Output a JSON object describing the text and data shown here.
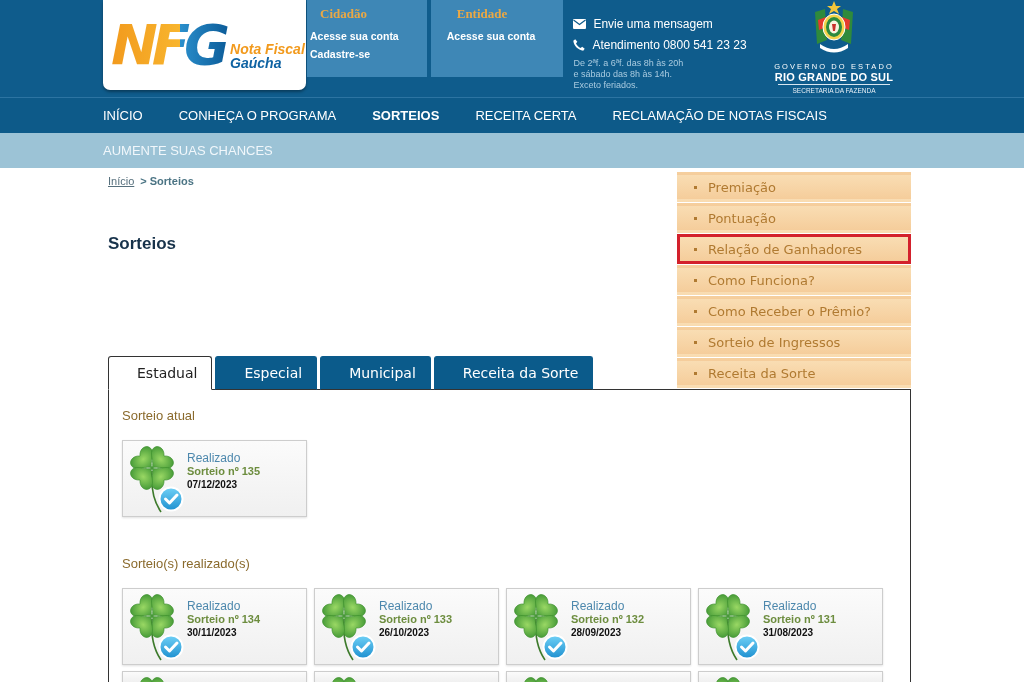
{
  "header": {
    "logo": {
      "mark": "NFG",
      "line_1": "Nota Fiscal",
      "line_2": "Gaúcha"
    },
    "account_panels": [
      {
        "title": "Cidadão",
        "links": [
          "Acesse sua conta",
          "Cadastre-se"
        ]
      },
      {
        "title": "Entidade",
        "links": [
          "Acesse sua conta"
        ]
      }
    ],
    "contact": {
      "items": [
        {
          "kind": "email",
          "label": "Envie uma mensagem"
        },
        {
          "kind": "phone",
          "label": "Atendimento 0800 541 23 23"
        }
      ],
      "hours": [
        "De 2ªf. a 6ªf. das 8h às 20h",
        "e sábado das 8h às 14h.",
        "Exceto feriados."
      ]
    },
    "government": {
      "line_1": "GOVERNO DO ESTADO",
      "line_2": "RIO GRANDE DO SUL",
      "line_3": "SECRETARIA DA FAZENDA"
    }
  },
  "nav": [
    {
      "label": "INÍCIO",
      "selected": false
    },
    {
      "label": "CONHEÇA O PROGRAMA",
      "selected": false
    },
    {
      "label": "SORTEIOS",
      "selected": true
    },
    {
      "label": "RECEITA CERTA",
      "selected": false
    },
    {
      "label": "RECLAMAÇÃO DE NOTAS FISCAIS",
      "selected": false
    }
  ],
  "subnav": [
    "AUMENTE SUAS CHANCES"
  ],
  "breadcrumb": [
    {
      "kind": "link",
      "label": "Início"
    },
    {
      "kind": "current",
      "label": "> Sorteios"
    }
  ],
  "page_title": "Sorteios",
  "sidebar": [
    {
      "label": "Premiação",
      "highlighted": false
    },
    {
      "label": "Pontuação",
      "highlighted": false
    },
    {
      "label": "Relação de Ganhadores",
      "highlighted": true
    },
    {
      "label": "Como Funciona?",
      "highlighted": false
    },
    {
      "label": "Como Receber o Prêmio?",
      "highlighted": false
    },
    {
      "label": "Sorteio de Ingressos",
      "highlighted": false
    },
    {
      "label": "Receita da Sorte",
      "highlighted": false
    }
  ],
  "tabs": [
    {
      "label": "Estadual",
      "selected": true
    },
    {
      "label": "Especial",
      "selected": false
    },
    {
      "label": "Municipal",
      "selected": false
    },
    {
      "label": "Receita da Sorte",
      "selected": false
    }
  ],
  "current_section": {
    "heading": "Sorteio atual",
    "draws": [
      {
        "kind": "full",
        "status": "Realizado",
        "title": "Sorteio nº 135",
        "date": "07/12/2023"
      }
    ]
  },
  "past_section": {
    "heading": "Sorteio(s) realizado(s)",
    "draws": [
      {
        "kind": "full",
        "status": "Realizado",
        "title": "Sorteio nº 134",
        "date": "30/11/2023"
      },
      {
        "kind": "full",
        "status": "Realizado",
        "title": "Sorteio nº 133",
        "date": "26/10/2023"
      },
      {
        "kind": "full",
        "status": "Realizado",
        "title": "Sorteio nº 132",
        "date": "28/09/2023"
      },
      {
        "kind": "full",
        "status": "Realizado",
        "title": "Sorteio nº 131",
        "date": "31/08/2023"
      },
      {
        "kind": "cut"
      },
      {
        "kind": "cut"
      },
      {
        "kind": "cut"
      },
      {
        "kind": "cut"
      }
    ]
  }
}
